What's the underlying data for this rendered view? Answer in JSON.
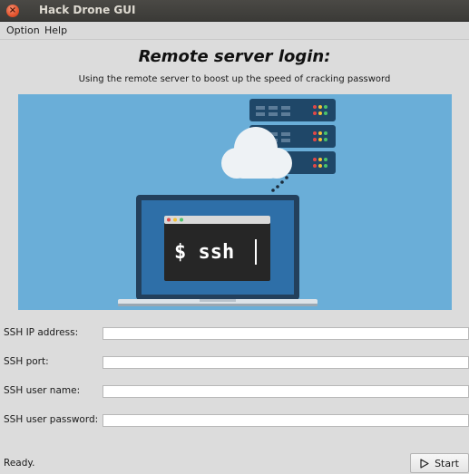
{
  "window": {
    "title": "Hack Drone GUI",
    "close_icon": "close-icon"
  },
  "menu": {
    "items": [
      "Option",
      "Help"
    ]
  },
  "heading": "Remote server login:",
  "subheading": "Using the remote server to boost up the speed of cracking password",
  "illustration": {
    "terminal_text": "$ ssh"
  },
  "form": {
    "fields": [
      {
        "label": "SSH IP address:",
        "value": ""
      },
      {
        "label": "SSH port:",
        "value": ""
      },
      {
        "label": "SSH user name:",
        "value": ""
      },
      {
        "label": "SSH user password:",
        "value": ""
      }
    ]
  },
  "status": "Ready.",
  "start_button": {
    "label": "Start",
    "icon": "play-icon"
  },
  "colors": {
    "background": "#dcdcdc",
    "illustration_bg": "#6aaed8",
    "server": "#1f4768",
    "terminal": "#262626"
  }
}
